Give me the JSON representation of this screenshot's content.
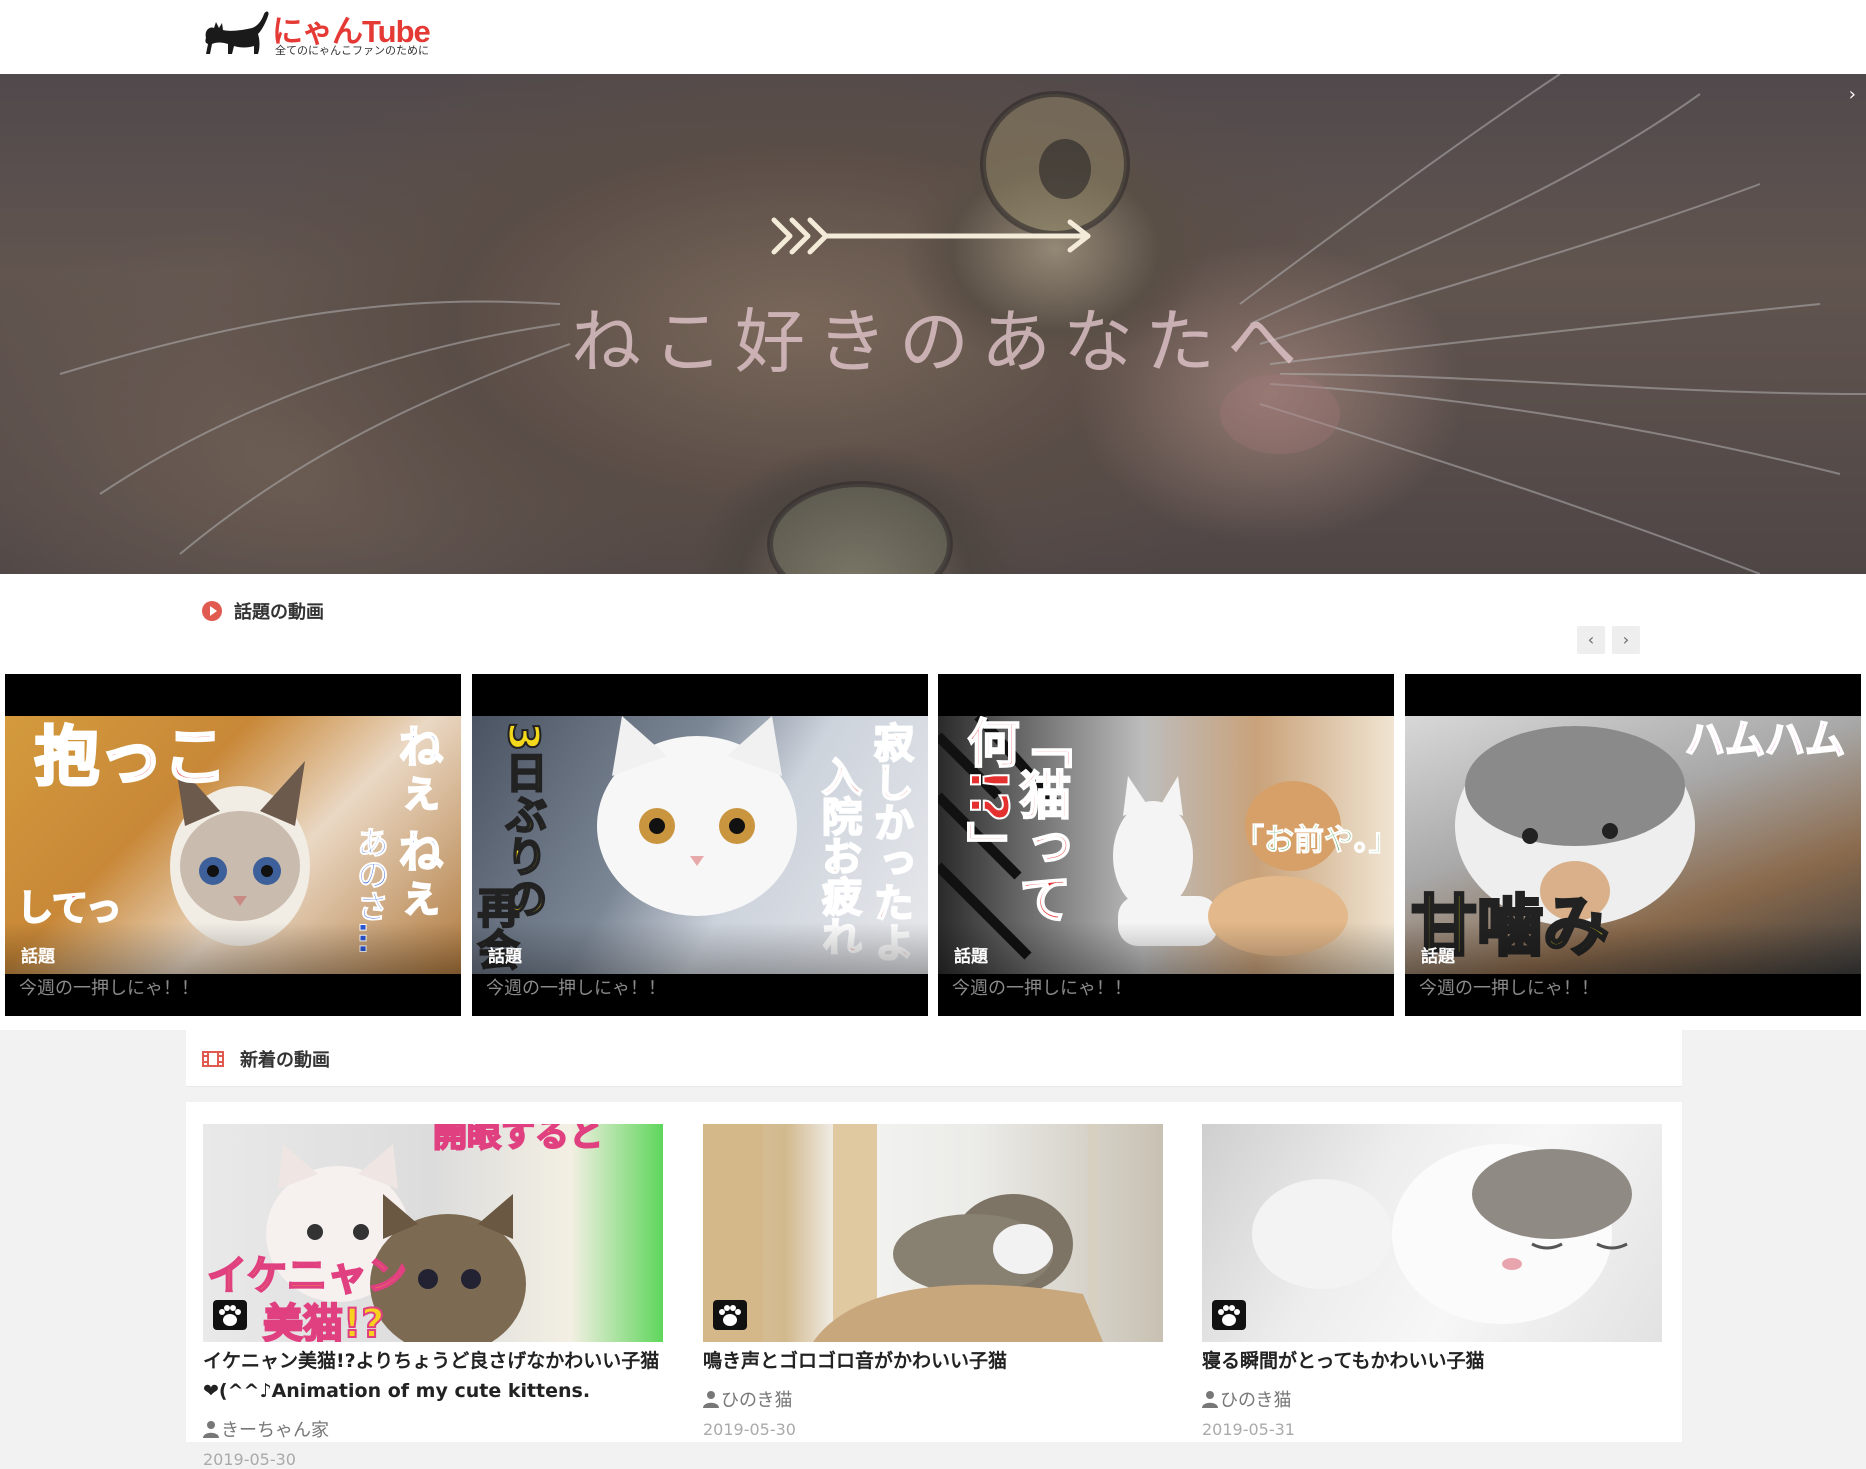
{
  "header": {
    "logo_title_jp": "にゃん",
    "logo_title_en": "Tube",
    "logo_tagline": "全てのにゃんこファンのために"
  },
  "hero": {
    "text": "ねこ好きのあなたへ",
    "next_control": "›"
  },
  "trending": {
    "section_label": "話題の動画",
    "prev_label": "‹",
    "next_label": "›",
    "cards": [
      {
        "tag": "話題",
        "caption": "今週の一押しにゃ！！",
        "thumb_text": [
          "抱っこ",
          "してっ",
          "ねぇ",
          "ねぇ",
          "あのさ…"
        ]
      },
      {
        "tag": "話題",
        "caption": "今週の一押しにゃ！！",
        "thumb_text": [
          "3日ぶりの",
          "再会",
          "寂しかったよ",
          "入院お疲れ"
        ]
      },
      {
        "tag": "話題",
        "caption": "今週の一押しにゃ！！",
        "thumb_text": [
          "「猫って何!?」",
          "「お前や。」"
        ]
      },
      {
        "tag": "話題",
        "caption": "今週の一押しにゃ！！",
        "thumb_text": [
          "ハムハム",
          "甘噛み"
        ]
      }
    ]
  },
  "new_videos": {
    "section_label": "新着の動画",
    "items": [
      {
        "title": "イケニャン美猫!?よりちょうど良さげなかわいい子猫❤(^^♪Animation of my cute kittens.",
        "author": "きーちゃん家",
        "date": "2019-05-30",
        "thumb_text": [
          "開眼すると",
          "イケニャン",
          "美猫!?"
        ]
      },
      {
        "title": "鳴き声とゴロゴロ音がかわいい子猫",
        "author": "ひのき猫",
        "date": "2019-05-30",
        "thumb_text": []
      },
      {
        "title": "寝る瞬間がとってもかわいい子猫",
        "author": "ひのき猫",
        "date": "2019-05-31",
        "thumb_text": []
      }
    ]
  },
  "colors": {
    "brand": "#e53935",
    "section_icon": "#e05a4f",
    "background": "#f2f2f2"
  },
  "icons": [
    "cat-logo-icon",
    "play-circle-icon",
    "film-icon",
    "paw-icon",
    "person-icon",
    "chevron-left-icon",
    "chevron-right-icon"
  ]
}
